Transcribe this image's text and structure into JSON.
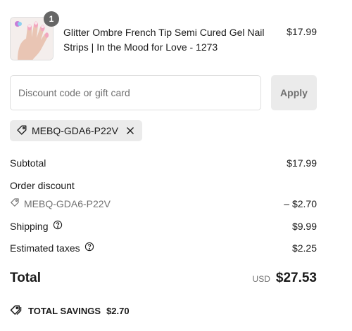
{
  "product": {
    "quantity": "1",
    "title": "Glitter Ombre French Tip Semi Cured Gel Nail Strips | In the Mood for Love - 1273",
    "price": "$17.99",
    "image_icon": "nail-strips-product-image"
  },
  "discount": {
    "placeholder": "Discount code or gift card",
    "value": "",
    "apply_label": "Apply",
    "applied_code": "MEBQ-GDA6-P22V"
  },
  "summary": {
    "subtotal_label": "Subtotal",
    "subtotal_value": "$17.99",
    "order_discount_label": "Order discount",
    "order_discount_code": "MEBQ-GDA6-P22V",
    "order_discount_value": "– $2.70",
    "shipping_label": "Shipping",
    "shipping_value": "$9.99",
    "taxes_label": "Estimated taxes",
    "taxes_value": "$2.25"
  },
  "total": {
    "label": "Total",
    "currency": "USD",
    "amount": "$27.53"
  },
  "savings": {
    "label": "TOTAL SAVINGS",
    "value": "$2.70"
  },
  "colors": {
    "text": "#1a1a1a",
    "muted": "#707070",
    "border": "#dedede",
    "chip_bg": "#ebebeb",
    "badge_bg": "#666666"
  }
}
